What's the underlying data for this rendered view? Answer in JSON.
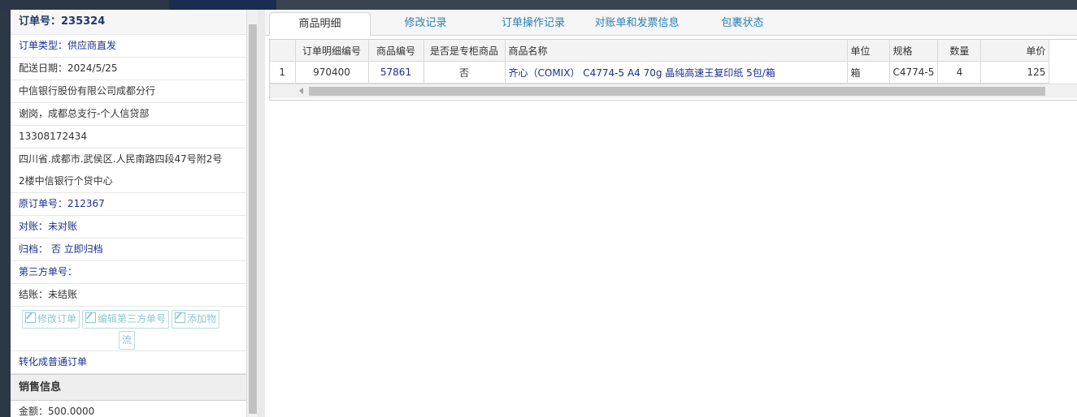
{
  "order": {
    "number_label": "订单号：235324",
    "type_label": "订单类型：供应商直发",
    "delivery_date": "配送日期：2024/5/25",
    "company": "中信银行股份有限公司成都分行",
    "contact": "谢岗，成都总支行-个人信贷部",
    "phone": "13308172434",
    "address_line1": "四川省.成都市.武侯区.人民南路四段47号附2号",
    "address_line2": "2楼中信银行个贷中心",
    "original_order": "原订单号：212367",
    "reconcile": "对账：未对账",
    "archive": "归档：  否 立即归档",
    "third_party": "第三方单号：",
    "settlement": "结账：未结账"
  },
  "actions": {
    "edit_order": "修改订单",
    "edit_third_party": "编辑第三方单号",
    "add_logistics_1": "添加物",
    "add_logistics_2": "流",
    "convert": "转化成普通订单"
  },
  "sales": {
    "header": "销售信息",
    "amount": "金额：500.0000"
  },
  "tabs": [
    "商品明细",
    "修改记录",
    "订单操作记录",
    "对账单和发票信息",
    "包裹状态"
  ],
  "table": {
    "columns": [
      "",
      "订单明细编号",
      "商品编号",
      "是否是专柜商品",
      "商品名称",
      "单位",
      "规格",
      "数量",
      "单价"
    ],
    "rows": [
      [
        "1",
        "970400",
        "57861",
        "否",
        "齐心（COMIX） C4774-5 A4 70g 晶纯高速王复印纸 5包/箱",
        "箱",
        "C4774-5",
        "4",
        "125"
      ]
    ]
  },
  "colors": {
    "link": "#1a2f8f",
    "tab_link": "#2a7fb8",
    "disabled_button": "#8cc6d6"
  }
}
